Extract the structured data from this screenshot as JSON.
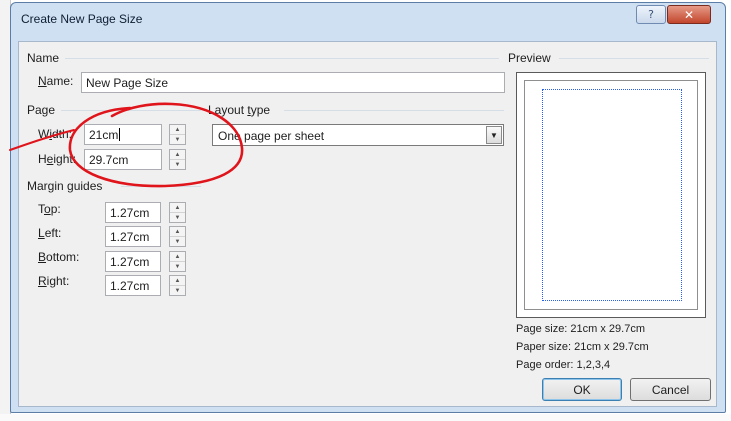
{
  "dialog": {
    "title": "Create New Page Size",
    "help_glyph": "?",
    "close_glyph": "✕"
  },
  "name_group": {
    "heading": "Name",
    "label": {
      "hotkey": "N",
      "rest": "ame:"
    },
    "value": "New Page Size"
  },
  "page_group": {
    "heading": "Page",
    "width": {
      "label_pre": "W",
      "hotkey": "i",
      "label_post": "dth:",
      "value": "21cm"
    },
    "height": {
      "label_pre": "H",
      "hotkey": "e",
      "label_post": "ight:",
      "value": "29.7cm"
    }
  },
  "layout_group": {
    "heading_pre": "Layout ",
    "heading_hotkey": "t",
    "heading_post": "ype",
    "selected": "One page per sheet"
  },
  "margin_group": {
    "heading": "Margin guides",
    "top": {
      "label_pre": "T",
      "hotkey": "o",
      "label_post": "p:",
      "value": "1.27cm"
    },
    "left": {
      "label_pre": "",
      "hotkey": "L",
      "label_post": "eft:",
      "value": "1.27cm"
    },
    "bottom": {
      "label_pre": "",
      "hotkey": "B",
      "label_post": "ottom:",
      "value": "1.27cm"
    },
    "right": {
      "label_pre": "",
      "hotkey": "R",
      "label_post": "ight:",
      "value": "1.27cm"
    }
  },
  "preview": {
    "heading": "Preview",
    "page_size": "Page size: 21cm x 29.7cm",
    "paper_size": "Paper size: 21cm x 29.7cm",
    "page_order": "Page order: 1,2,3,4"
  },
  "buttons": {
    "ok": "OK",
    "cancel": "Cancel"
  },
  "spin_glyphs": {
    "up": "▲",
    "down": "▼"
  },
  "dropdown_glyph": "▼",
  "colors": {
    "annotation": "#e0141b",
    "preview_margin": "#2a5ee8",
    "dialog_frame": "#cfe0f2"
  }
}
